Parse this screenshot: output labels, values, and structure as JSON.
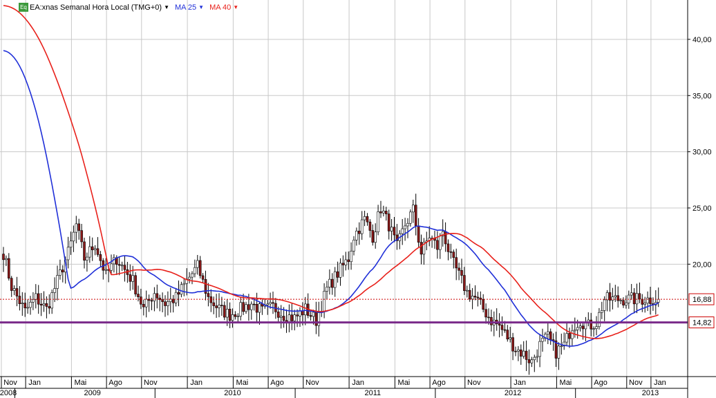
{
  "legend": {
    "symbol_badge": "Eq",
    "instrument": "EA:xnas Semanal Hora Local (TMG+0)",
    "ma25_label": "MA 25",
    "ma40_label": "MA 40",
    "dropdown_glyph": "▼"
  },
  "colors": {
    "candle_up": "#ffffff",
    "candle_down": "#8b1a1a",
    "candle_outline": "#000000",
    "ma25": "#1f2fd8",
    "ma40": "#e8201a",
    "price_line": "#cc0000",
    "support_line": "#7a2a8a",
    "grid": "#c8c8c8"
  },
  "chart_data": {
    "type": "candlestick",
    "ylim": [
      10.0,
      43.5
    ],
    "y_ticks": [
      "40,00",
      "35,00",
      "30,00",
      "25,00",
      "20,00"
    ],
    "y_tick_values": [
      40,
      35,
      30,
      25,
      20
    ],
    "x_month_labels": [
      "Nov",
      "Jan",
      "Mai",
      "Ago",
      "Nov",
      "Jan",
      "Mai",
      "Ago",
      "Nov",
      "Jan",
      "Mai",
      "Ago",
      "Nov",
      "Jan",
      "Mai",
      "Ago",
      "Nov",
      "Jan"
    ],
    "x_month_weeks": [
      0,
      9,
      26,
      39,
      52,
      69,
      86,
      99,
      112,
      129,
      146,
      159,
      172,
      189,
      206,
      219,
      232,
      241
    ],
    "x_year_labels": [
      "2008",
      "2009",
      "2010",
      "2011",
      "2012",
      "2013"
    ],
    "x_year_weeks": [
      0,
      33,
      85,
      137,
      189,
      240
    ],
    "year_boundaries": [
      5,
      57,
      109,
      161,
      213
    ],
    "last_price": 16.88,
    "last_price_label": "16,88",
    "support_level": 14.82,
    "support_label": "14,82",
    "anchor_weeks": [
      0,
      3,
      8,
      12,
      16,
      20,
      24,
      27,
      30,
      34,
      38,
      42,
      45,
      48,
      52,
      56,
      60,
      64,
      68,
      72,
      76,
      80,
      84,
      88,
      92,
      96,
      100,
      104,
      108,
      112,
      116,
      120,
      124,
      128,
      130,
      134,
      137,
      140,
      143,
      146,
      149,
      152,
      155,
      158,
      161,
      163,
      166,
      169,
      172,
      175,
      178,
      181,
      184,
      187,
      190,
      193,
      196,
      199,
      202,
      205,
      208,
      211,
      214,
      217,
      220,
      223,
      226,
      229,
      232,
      235,
      238,
      241,
      244
    ],
    "anchor_closes": [
      21.0,
      18.0,
      15.8,
      17.0,
      16.0,
      18.5,
      21.0,
      23.5,
      20.5,
      21.8,
      19.0,
      20.5,
      19.5,
      18.5,
      16.0,
      17.5,
      16.5,
      17.0,
      18.5,
      19.8,
      17.0,
      16.0,
      15.5,
      16.0,
      16.5,
      15.8,
      16.2,
      15.5,
      15.2,
      16.0,
      15.0,
      17.8,
      19.2,
      20.5,
      22.5,
      24.0,
      22.5,
      25.0,
      23.5,
      21.5,
      23.5,
      24.8,
      21.0,
      22.5,
      21.5,
      23.0,
      20.5,
      19.0,
      17.5,
      17.0,
      16.0,
      15.0,
      14.5,
      13.5,
      12.5,
      12.0,
      11.3,
      12.8,
      13.5,
      12.2,
      12.8,
      14.5,
      15.0,
      14.5,
      14.8,
      16.88,
      16.88,
      16.88,
      16.88,
      16.88,
      16.88,
      16.88,
      16.88
    ],
    "ma25_start": 39.0,
    "ma40_start": 43.0
  }
}
